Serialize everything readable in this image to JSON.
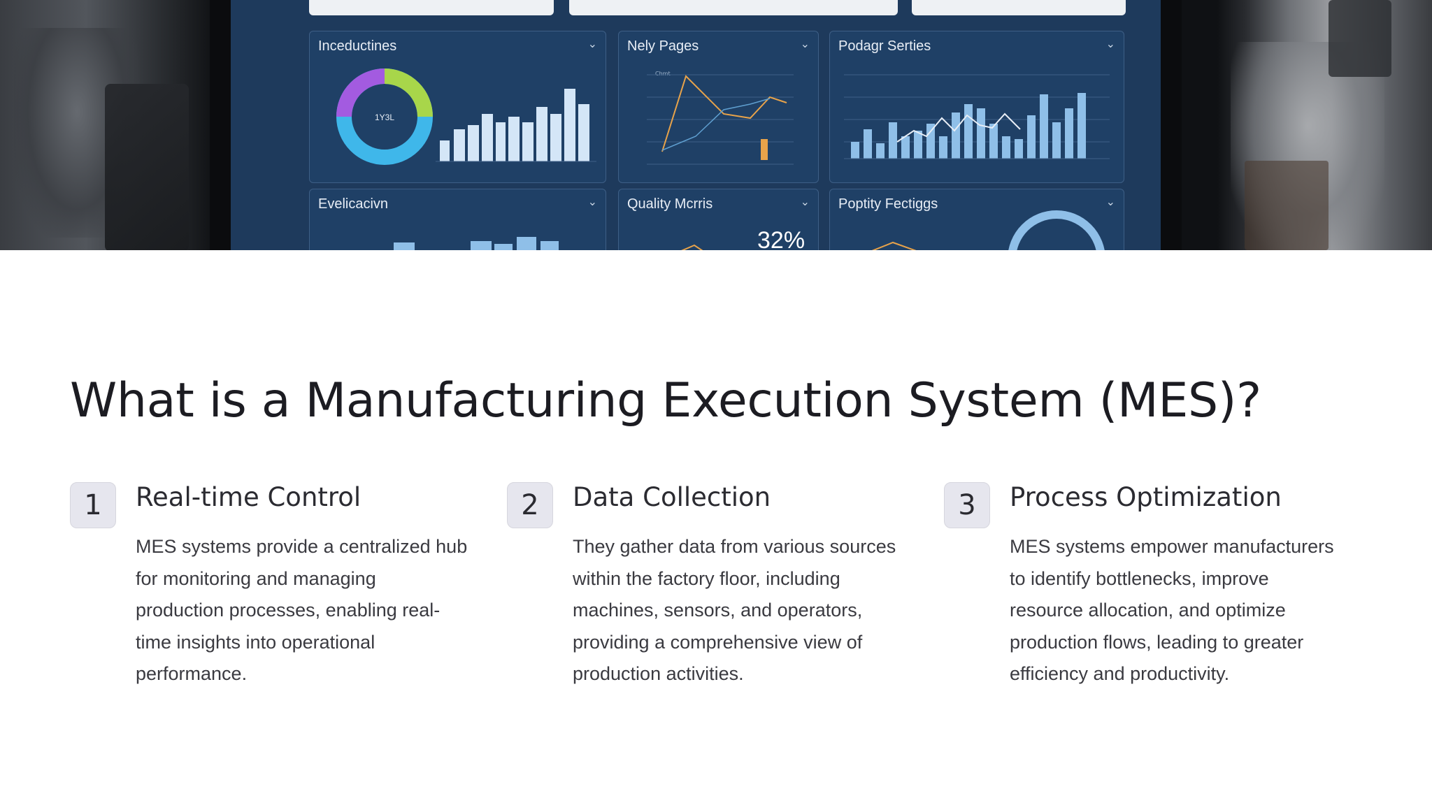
{
  "hero": {
    "panels": [
      {
        "title": "Inceductines",
        "donut_label": "1Y3L"
      },
      {
        "title": "Nely Pages",
        "legend": "Chmt"
      },
      {
        "title": "Podagr Serties"
      },
      {
        "title": "Evelicacivn"
      },
      {
        "title": "Quality Mcrris",
        "big_value": "32%"
      },
      {
        "title": "Poptity Fectiggs"
      }
    ],
    "colors": {
      "screen": "#1e3a5c",
      "panel": "#1f4066",
      "bar": "#d4e6f7",
      "bar_blue": "#8fbfe8",
      "line": "#e8a34a",
      "donut_purple": "#a35be0",
      "donut_green": "#a8d64a",
      "donut_cyan": "#3fb7ea"
    }
  },
  "heading": "What is a Manufacturing Execution System (MES)?",
  "items": [
    {
      "number": "1",
      "title": "Real-time Control",
      "lines": [
        "MES systems provide a centralized hub",
        "for monitoring and managing",
        "production processes, enabling real-",
        "time insights into operational",
        "performance."
      ]
    },
    {
      "number": "2",
      "title": "Data Collection",
      "lines": [
        "They gather data from various sources",
        "within the factory floor, including",
        "machines, sensors, and operators,",
        "providing a comprehensive view of",
        "production activities."
      ]
    },
    {
      "number": "3",
      "title": "Process Optimization",
      "lines": [
        "MES systems empower manufacturers",
        "to identify bottlenecks, improve",
        "resource allocation, and optimize",
        "production flows, leading to greater",
        "efficiency and productivity."
      ]
    }
  ]
}
